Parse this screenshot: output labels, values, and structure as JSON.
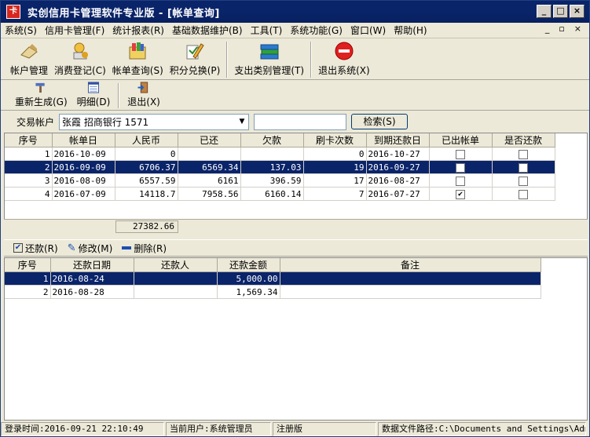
{
  "window": {
    "title": "实创信用卡管理软件专业版 - [帐单查询]",
    "icon_text": "卡"
  },
  "menu": [
    "系统(S)",
    "信用卡管理(F)",
    "统计报表(R)",
    "基础数据维护(B)",
    "工具(T)",
    "系统功能(G)",
    "窗口(W)",
    "帮助(H)"
  ],
  "toolbar_main": [
    {
      "label": "帐户管理",
      "icon": "account-icon"
    },
    {
      "label": "消费登记(C)",
      "icon": "consume-icon"
    },
    {
      "label": "帐单查询(S)",
      "icon": "bill-icon"
    },
    {
      "label": "积分兑换(P)",
      "icon": "points-icon"
    },
    {
      "label": "支出类别管理(T)",
      "icon": "books-icon"
    },
    {
      "label": "退出系统(X)",
      "icon": "exit-icon"
    }
  ],
  "toolbar_sub": [
    {
      "label": "重新生成(G)",
      "icon": "regenerate-icon"
    },
    {
      "label": "明细(D)",
      "icon": "detail-icon"
    },
    {
      "label": "退出(X)",
      "icon": "door-exit-icon"
    }
  ],
  "filter": {
    "label": "交易帐户",
    "account_value": "张霞 招商银行 1571",
    "search_label": "检索(S)"
  },
  "bills": {
    "columns": [
      "序号",
      "帐单日",
      "人民币",
      "已还",
      "欠款",
      "刷卡次数",
      "到期还款日",
      "已出帐单",
      "是否还款"
    ],
    "rows": [
      {
        "no": "1",
        "date": "2016-10-09",
        "rmb": "0",
        "paid": "",
        "owe": "",
        "count": "0",
        "due": "2016-10-27",
        "issued": false,
        "repaid": false
      },
      {
        "no": "2",
        "date": "2016-09-09",
        "rmb": "6706.37",
        "paid": "6569.34",
        "owe": "137.03",
        "count": "19",
        "due": "2016-09-27",
        "issued": false,
        "repaid": false
      },
      {
        "no": "3",
        "date": "2016-08-09",
        "rmb": "6557.59",
        "paid": "6161",
        "owe": "396.59",
        "count": "17",
        "due": "2016-08-27",
        "issued": false,
        "repaid": false
      },
      {
        "no": "4",
        "date": "2016-07-09",
        "rmb": "14118.7",
        "paid": "7958.56",
        "owe": "6160.14",
        "count": "7",
        "due": "2016-07-27",
        "issued": true,
        "repaid": false
      }
    ],
    "total": "27382.66"
  },
  "payment_toolbar": [
    {
      "label": "还款(R)",
      "icon": "check-icon"
    },
    {
      "label": "修改(M)",
      "icon": "pencil-icon"
    },
    {
      "label": "删除(R)",
      "icon": "minus-icon"
    }
  ],
  "payments": {
    "columns": [
      "序号",
      "还款日期",
      "还款人",
      "还款金额",
      "备注"
    ],
    "rows": [
      {
        "no": "1",
        "date": "2016-08-24",
        "payer": "",
        "amount": "5,000.00",
        "note": ""
      },
      {
        "no": "2",
        "date": "2016-08-28",
        "payer": "",
        "amount": "1,569.34",
        "note": ""
      }
    ]
  },
  "status": {
    "login_time": "登录时间:2016-09-21 22:10:49",
    "current_user": "当前用户:系统管理员",
    "edition": "注册版",
    "data_path": "数据文件路径:C:\\Documents and Settings\\Admin"
  },
  "colors": {
    "title_bg": "#0A246A",
    "selection": "#0A246A",
    "face": "#ECE9D8"
  }
}
